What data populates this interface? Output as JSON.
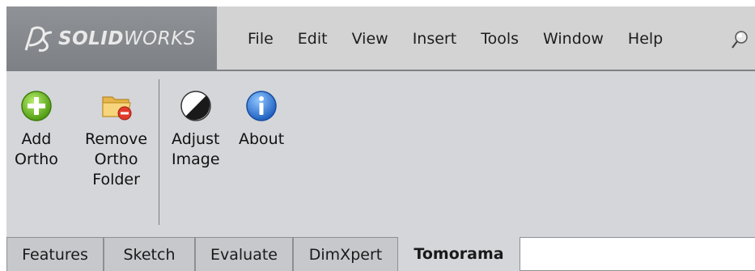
{
  "app": {
    "logo_text_bold": "SOLID",
    "logo_text_light": "WORKS",
    "brand_color": "#8a8d91"
  },
  "menu": {
    "items": [
      "File",
      "Edit",
      "View",
      "Insert",
      "Tools",
      "Window",
      "Help"
    ],
    "pin_icon": "pushpin-icon"
  },
  "toolbar": {
    "tools": [
      {
        "label": "Add\nOrtho",
        "icon": "add-circle-icon"
      },
      {
        "label": "Remove\nOrtho\nFolder",
        "icon": "folder-remove-icon"
      },
      {
        "label": "Adjust\nImage",
        "icon": "contrast-icon"
      },
      {
        "label": "About",
        "icon": "info-icon"
      }
    ]
  },
  "tabs": {
    "items": [
      "Features",
      "Sketch",
      "Evaluate",
      "DimXpert",
      "Tomorama"
    ],
    "active": "Tomorama"
  }
}
